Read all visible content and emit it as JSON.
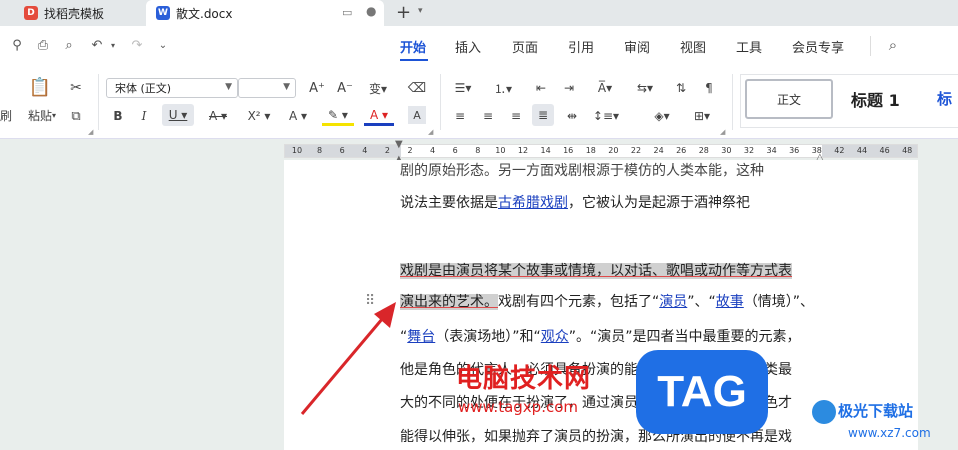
{
  "tabs": [
    {
      "label": "找稻壳模板",
      "icon": "docer-icon",
      "color": "#e44b3c"
    },
    {
      "label": "散文.docx",
      "icon": "word-doc-icon",
      "color": "#2b5fd9",
      "active": true
    }
  ],
  "menu": [
    "开始",
    "插入",
    "页面",
    "引用",
    "审阅",
    "视图",
    "工具",
    "会员专享"
  ],
  "ribbon": {
    "paste_label": "粘贴",
    "font_name": "宋体 (正文)",
    "font_size": "",
    "cut_side_label": "刷",
    "style_normal": "正文",
    "style_h1": "标题 1",
    "style_h2": "标"
  },
  "ruler_ticks": [
    "10",
    "8",
    "6",
    "4",
    "2",
    "2",
    "4",
    "6",
    "8",
    "10",
    "12",
    "14",
    "16",
    "18",
    "20",
    "22",
    "24",
    "26",
    "28",
    "30",
    "32",
    "34",
    "36",
    "38",
    "42",
    "44",
    "46",
    "48"
  ],
  "document": {
    "line0": "剧的原始形态。另一方面戏剧根源于模仿的人类本能，这种",
    "line1_a": "说法主要依据是",
    "line1_link": "古希腊戏剧",
    "line1_b": "，它被认为是起源于酒神祭祀",
    "line2": "戏剧是由演员将某个故事或情境，以对话、歌唱或动作等方式表",
    "line3_hl": "演出来的艺术。",
    "line3_a": "戏剧有四个元素，包括了“",
    "line3_l1": "演员",
    "line3_b": "”、“",
    "line3_l2": "故事",
    "line3_c": "（情境）”、",
    "line4_a": "“",
    "line4_l1": "舞台",
    "line4_b": "（表演场地）”和“",
    "line4_l2": "观众",
    "line4_c": "”。“演员”是四者当中最重要的元素，",
    "line5": "他是角色的代言人，必须具备扮演的能力，戏剧与其他艺术类最",
    "line6": "大的不同的处便在于扮演了，通过演员的扮演，剧本中的角色才",
    "line7": "能得以伸张，如果抛弃了演员的扮演，那么所演出的便不再是戏"
  },
  "watermark": {
    "text": "电脑技术网",
    "url": "www.tagxp.com",
    "tag": "TAG",
    "brand": "极光下载站",
    "brand_url": "www.xz7.com"
  }
}
